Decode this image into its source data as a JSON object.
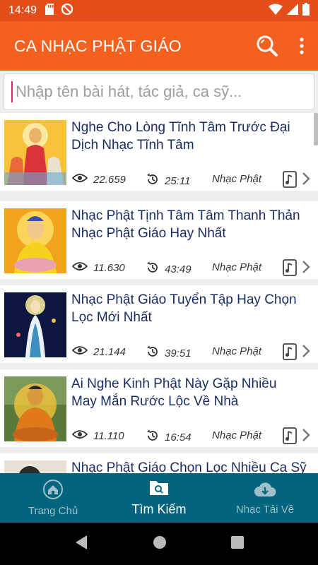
{
  "status": {
    "time": "14:49"
  },
  "app_bar": {
    "title": "CA NHẠC PHẬT GIÁO"
  },
  "search": {
    "placeholder": "Nhập tên bài hát, tác giả, ca sỹ..."
  },
  "items": [
    {
      "title": "Nghe Cho Lòng Tĩnh Tâm Trước Đại Dịch Nhạc Tĩnh Tâm",
      "views": "22.659",
      "duration": "25:11",
      "category": "Nhạc Phật"
    },
    {
      "title": "Nhạc Phật Tịnh Tâm Tâm Thanh Thản Nhạc Phật Giáo Hay Nhất",
      "views": "11.630",
      "duration": "43:49",
      "category": "Nhạc Phật"
    },
    {
      "title": "Nhạc Phật Giáo Tuyển Tập Hay Chọn Lọc Mới Nhất",
      "views": "21.144",
      "duration": "39:51",
      "category": "Nhạc Phật"
    },
    {
      "title": "Ai Nghe Kinh Phật Này Gặp Nhiều May Mắn Rước Lộc Về Nhà",
      "views": "11.110",
      "duration": "16:54",
      "category": "Nhạc Phật"
    },
    {
      "title": "Nhạc Phật Giáo Chọn Lọc Nhiều Ca Sỹ",
      "views": "",
      "duration": "",
      "category": ""
    }
  ],
  "bottom_nav": {
    "home": "Trang Chủ",
    "search": "Tìm Kiếm",
    "downloads": "Nhạc Tải Về"
  },
  "colors": {
    "app_bar": "#f4611f",
    "status_bar": "#e54e18",
    "bottom_nav": "#03647d",
    "title_text": "#1a2b5e"
  }
}
